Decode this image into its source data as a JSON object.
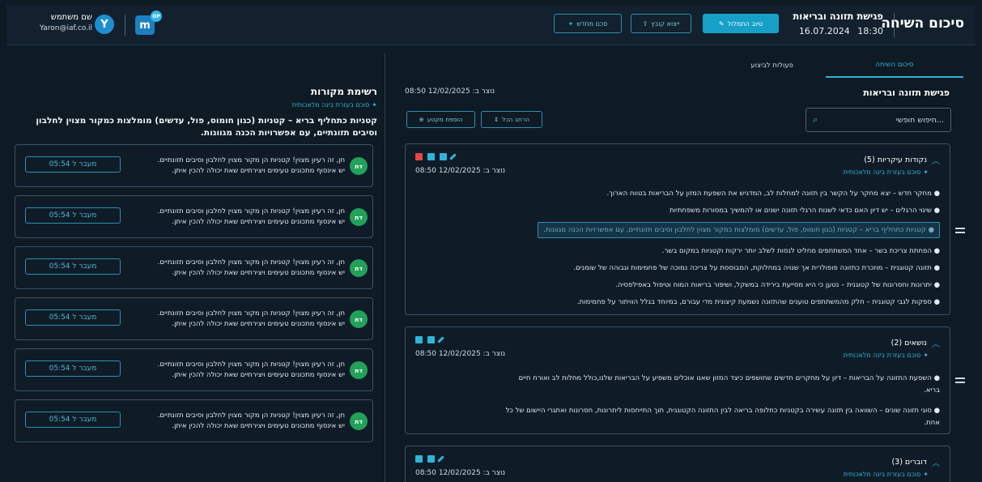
{
  "header": {
    "title": "סיכום השיחה",
    "meeting_name": "פגישת תזונה ובריאות",
    "date": "16.07.2024",
    "time": "18:30",
    "upload_label": "טיוב התמלול",
    "export_label": "ייצוא קובץ",
    "new_summary_label": "סכם מחדש",
    "user_name": "שם משתמש",
    "user_email": "Yaron@iaf.co.il",
    "avatar_letter": "Y",
    "logo_text": "m",
    "logo_badge": "OP"
  },
  "tabs": {
    "active": "סיכום השיחה",
    "other": "פעולות לביצוע"
  },
  "main": {
    "subtitle": "פגישת תזונה ובריאות",
    "created": "נוצר ב: 12/02/2025 08:50",
    "search_placeholder": "חיפוש חופשי...",
    "expand_all_label": "הרחב הכל",
    "add_section_label": "הוספת מקטע"
  },
  "sections": [
    {
      "title": "נקודות עיקריות (5)",
      "ai_label": "סוכם בעזרת בינה מלאכותית",
      "created": "נוצר ב: 12/02/2025 08:50",
      "bullets": [
        "● מחקר חדש – יצא מחקר על הקשר בין תזונה למחלות לב, המדגיש את השפעת המזון על הבריאות בטווח הארוך.",
        "● שינוי הרגלים – יש דיון האם כדאי לשנות הרגלי תזונה ישנים או להמשיך במסורות משפחתיות",
        "● קטניות כתחליף בריא – קטניות (כגון חומוס, פול, עדשים) מומלצות כמקור מצוין לחלבון וסיבים תזונתיים, עם אפשרויות הכנה מגוונות.",
        "● הפחתת צריכת בשר – אחד המשתתפים מחליט לנסות לשלב יותר ירקות וקטניות במקום בשר.",
        "● תזונה קטוגנית – מוזכרת כתזונה פופולרית אך שנויה במחלוקת, המבוססת על צריכה נמוכה של פחמימות וגבוהה של שומנים.",
        "● יתרונות וחסרונות של קטוגנית – נטען כי היא מסייעת בירידה במשקל, ושיפור בריאות המוח וטיפול באפילפסיה.",
        "● ספקות לגבי קטוגנית – חלק מהמשתתפים טוענים שהתזונה נשמעת קיצונית מדי עבורם, במיוחד בגלל הוויתור על פחמימות."
      ]
    },
    {
      "title": "נושאים (2)",
      "ai_label": "סוכם בעזרת בינה מלאכותית",
      "created": "נוצר ב: 12/02/2025 08:50",
      "bullets": [
        "● השפעת התזונה על הבריאות – דיון על מחקרים חדשים שחושפים כיצד המזון שאנו אוכלים משפיע על הבריאות שלנו,כולל מחלות לב ואורח חיים בריא.",
        "● סוגי תזונה שונים – השוואה בין תזונה עשירה בקטניות כחלופה בריאה לבין התזונה הקטוגנית, תוך התייחסות ליתרונות, חסרונות ואתגרי היישום של כל אחת."
      ]
    },
    {
      "title": "דוברים (3)",
      "ai_label": "סוכם בעזרת בינה מלאכותית",
      "created": "נוצר ב: 12/02/2025 08:50"
    }
  ],
  "sources": {
    "title": "רשימת מקורות",
    "ai_label": "סוכם בעזרת בינה מלאכותית",
    "description": "קטניות כתחליף בריא – קטניות (כגון חומוס, פול, עדשים) מומלצות כמקור מצוין לחלבון וסיבים תזונתיים, עם אפשרויות הכנה מגוונות.",
    "items": [
      {
        "avatar": "דת",
        "line1": "חן, זה רעיון מצוין! קטניות הן מקור מצוין לחלבון וסיבים תזונתיים.",
        "line2": "יש אינסוף מתכונים טעימים ויצירתיים שאת יכולה להכין איתן.",
        "jump": "מעבר ל 05:54"
      },
      {
        "avatar": "דת",
        "line1": "חן, זה רעיון מצוין! קטניות הן מקור מצוין לחלבון וסיבים תזונתיים.",
        "line2": "יש אינסוף מתכונים טעימים ויצירתיים שאת יכולה להכין איתן.",
        "jump": "מעבר ל 05:54"
      },
      {
        "avatar": "דת",
        "line1": "חן, זה רעיון מצוין! קטניות הן מקור מצוין לחלבון וסיבים תזונתיים.",
        "line2": "יש אינסוף מתכונים טעימים ויצירתיים שאת יכולה להכין איתן.",
        "jump": "מעבר ל 05:54"
      },
      {
        "avatar": "דת",
        "line1": "חן, זה רעיון מצוין! קטניות הן מקור מצוין לחלבון וסיבים תזונתיים.",
        "line2": "יש אינסוף מתכונים טעימים ויצירתיים שאת יכולה להכין איתן.",
        "jump": "מעבר ל 05:54"
      },
      {
        "avatar": "דת",
        "line1": "חן, זה רעיון מצוין! קטניות הן מקור מצוין לחלבון וסיבים תזונתיים.",
        "line2": "יש אינסוף מתכונים טעימים ויצירתיים שאת יכולה להכין איתן.",
        "jump": "מעבר ל 05:54"
      },
      {
        "avatar": "דת",
        "line1": "חן, זה רעיון מצוין! קטניות הן מקור מצוין לחלבון וסיבים תזונתיים.",
        "line2": "יש אינסוף מתכונים טעימים ויצירתיים שאת יכולה להכין איתן.",
        "jump": "מעבר ל 05:54"
      }
    ]
  },
  "colors": {
    "accent": "#2fb5d8",
    "primary_button": "#16a0c8",
    "background": "#0e1a24",
    "source_avatar": "#22a15a",
    "delete_icon": "#e04848"
  }
}
